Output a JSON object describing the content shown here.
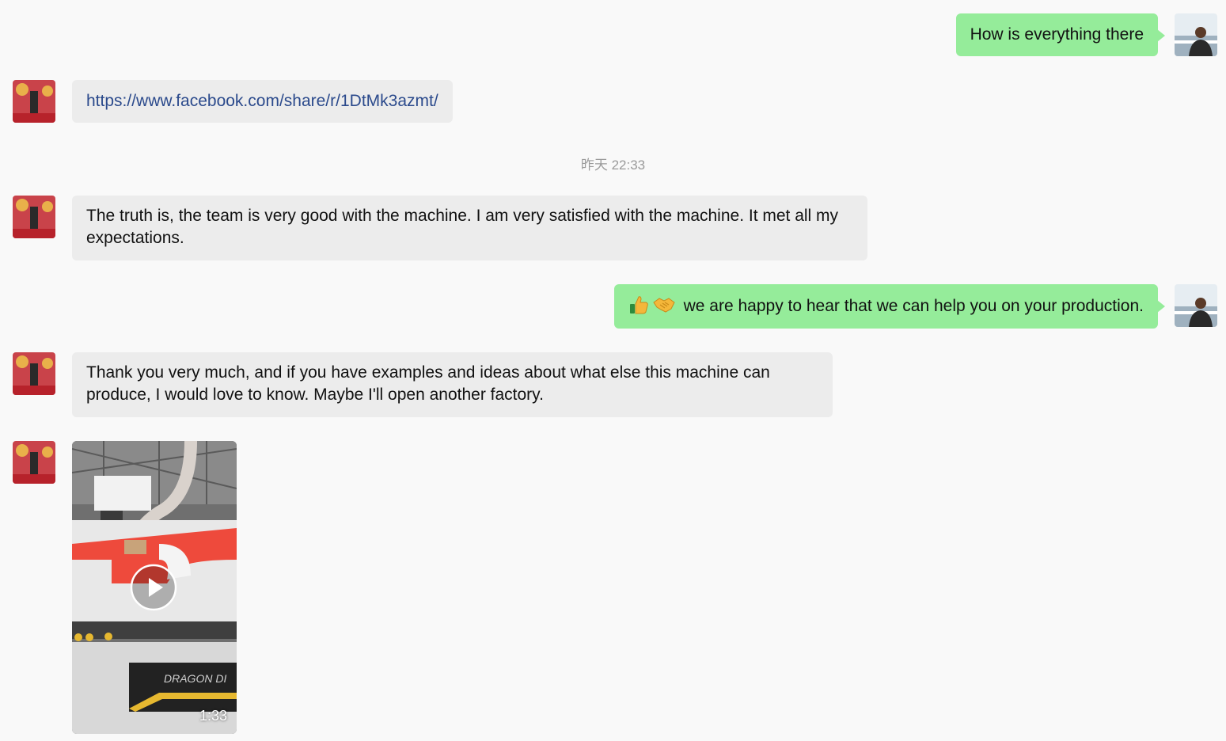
{
  "messages": [
    {
      "side": "out",
      "text": "How is everything there"
    },
    {
      "side": "in",
      "text": "https://www.facebook.com/share/r/1DtMk3azmt/"
    },
    {
      "side": "in",
      "text": "The truth is, the team is very good with the machine. I am very satisfied with the machine. It met all my expectations."
    },
    {
      "side": "out",
      "emoji": [
        "thumbs-up-icon",
        "handshake-icon"
      ],
      "text": "we are happy to hear that we can help you on your production."
    },
    {
      "side": "in",
      "text": "Thank you very much, and if you have examples and ideas about what else this machine can produce, I would love to know. Maybe I'll open another factory."
    },
    {
      "side": "in",
      "type": "video",
      "duration": "1:33",
      "thumbnail_text": "DRAGON DI"
    }
  ],
  "timestamp": "昨天 22:33",
  "colors": {
    "background": "#f9f9f9",
    "incoming_bubble": "#ececec",
    "outgoing_bubble": "#95ec9a",
    "link": "#2b4a8c",
    "timestamp": "#9a9a9a"
  }
}
